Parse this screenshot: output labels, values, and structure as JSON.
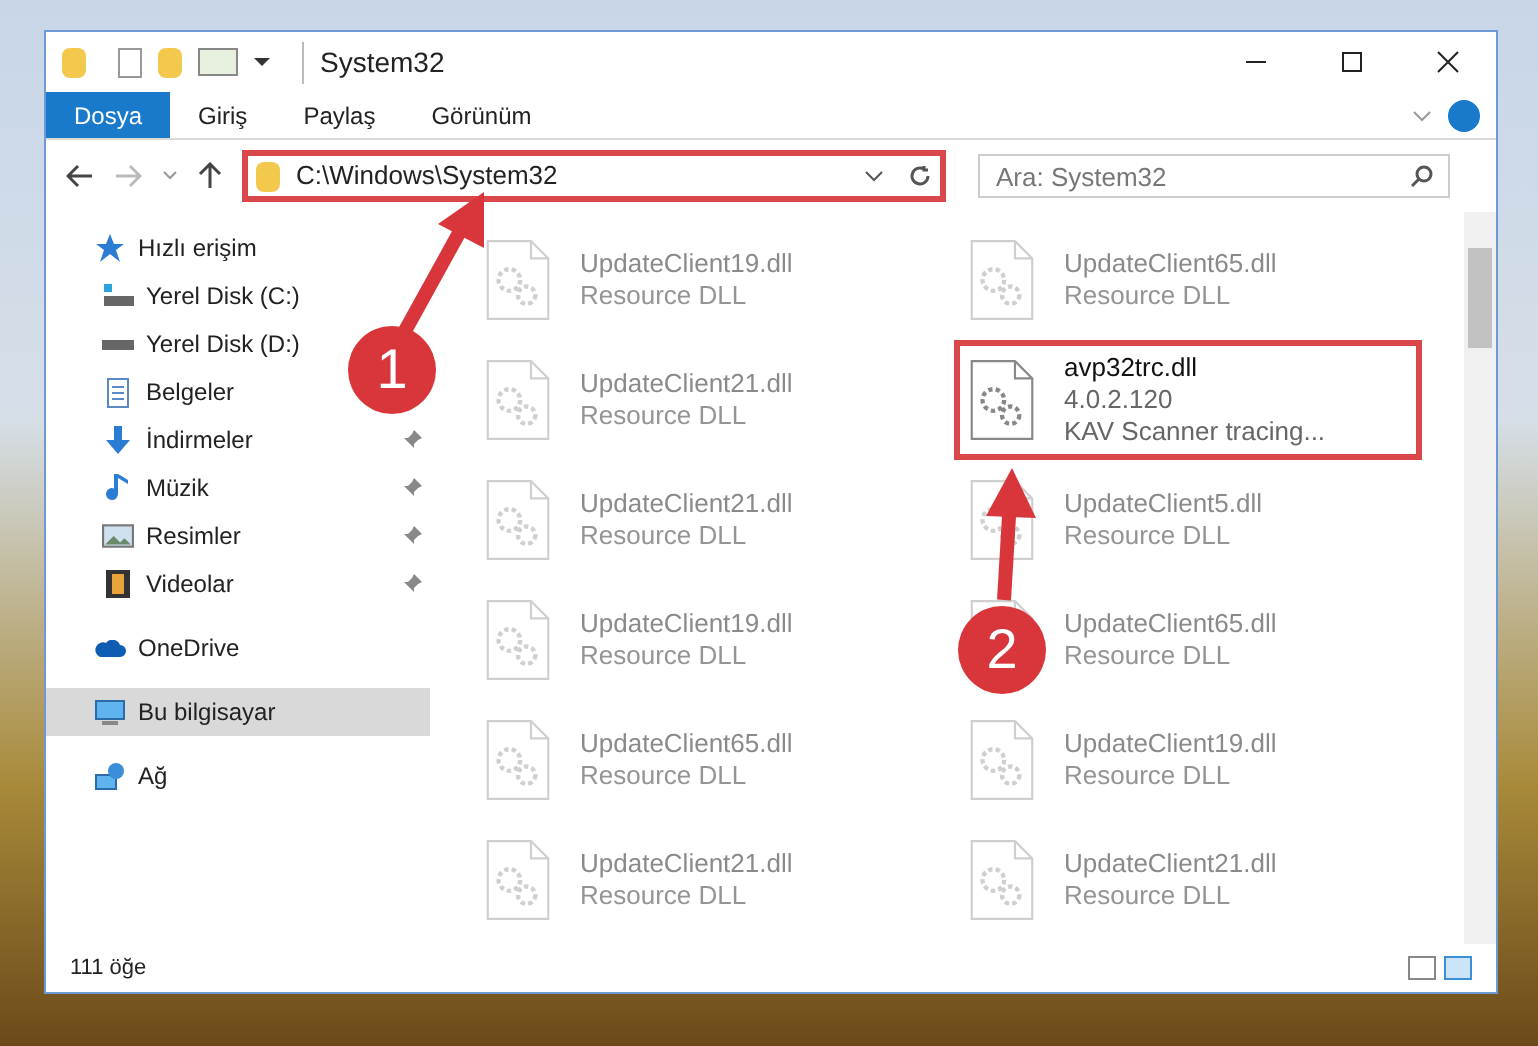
{
  "window": {
    "title": "System32"
  },
  "ribbon_tabs": [
    {
      "label": "Dosya",
      "selected": true
    },
    {
      "label": "Giriş",
      "selected": false
    },
    {
      "label": "Paylaş",
      "selected": false
    },
    {
      "label": "Görünüm",
      "selected": false
    }
  ],
  "address_bar": {
    "path": "C:\\Windows\\System32"
  },
  "search": {
    "placeholder": "Ara: System32"
  },
  "sidebar": {
    "items": [
      {
        "label": "Hızlı erişim",
        "selected": false,
        "children": [
          {
            "label": "Yerel Disk (C:)",
            "pinned": false,
            "selected": false
          },
          {
            "label": "Yerel Disk (D:)",
            "pinned": false,
            "selected": false
          },
          {
            "label": "Belgeler",
            "pinned": false,
            "selected": false
          },
          {
            "label": "İndirmeler",
            "pinned": true,
            "selected": false
          },
          {
            "label": "Müzik",
            "pinned": true,
            "selected": false
          },
          {
            "label": "Resimler",
            "pinned": true,
            "selected": false
          },
          {
            "label": "Videolar",
            "pinned": true,
            "selected": false
          }
        ]
      },
      {
        "label": "OneDrive",
        "selected": false
      },
      {
        "label": "Bu bilgisayar",
        "selected": true
      },
      {
        "label": "Ağ",
        "selected": false
      }
    ]
  },
  "files": {
    "columns": [
      [
        {
          "name": "UpdateClient19.dll",
          "lines": [
            "Resource DLL"
          ],
          "highlighted": false
        },
        {
          "name": "UpdateClient21.dll",
          "lines": [
            "Resource DLL"
          ],
          "highlighted": false
        },
        {
          "name": "UpdateClient21.dll",
          "lines": [
            "Resource DLL"
          ],
          "highlighted": false
        },
        {
          "name": "UpdateClient19.dll",
          "lines": [
            "Resource DLL"
          ],
          "highlighted": false
        },
        {
          "name": "UpdateClient65.dll",
          "lines": [
            "Resource DLL"
          ],
          "highlighted": false
        },
        {
          "name": "UpdateClient21.dll",
          "lines": [
            "Resource DLL"
          ],
          "highlighted": false
        }
      ],
      [
        {
          "name": "UpdateClient65.dll",
          "lines": [
            "Resource DLL"
          ],
          "highlighted": false
        },
        {
          "name": "avp32trc.dll",
          "lines": [
            "4.0.2.120",
            "KAV Scanner tracing..."
          ],
          "highlighted": true
        },
        {
          "name": "UpdateClient5.dll",
          "lines": [
            "Resource DLL"
          ],
          "highlighted": false
        },
        {
          "name": "UpdateClient65.dll",
          "lines": [
            "Resource DLL"
          ],
          "highlighted": false
        },
        {
          "name": "UpdateClient19.dll",
          "lines": [
            "Resource DLL"
          ],
          "highlighted": false
        },
        {
          "name": "UpdateClient21.dll",
          "lines": [
            "Resource DLL"
          ],
          "highlighted": false
        }
      ]
    ]
  },
  "status_bar": {
    "count": "111 öğe"
  },
  "annotations": [
    {
      "number": "1"
    },
    {
      "number": "2"
    }
  ]
}
